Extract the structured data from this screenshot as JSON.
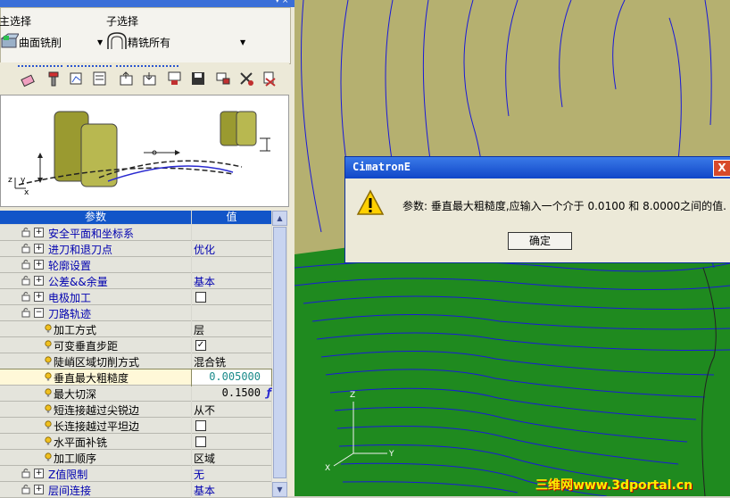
{
  "selectors": {
    "main_label": "主选择",
    "main_value": "曲面铣削",
    "sub_label": "子选择",
    "sub_value": "精铣所有"
  },
  "grid": {
    "header_param": "参数",
    "header_value": "值",
    "rows": [
      {
        "name": "安全平面和坐标系",
        "value": "",
        "kind": "group"
      },
      {
        "name": "进刀和退刀点",
        "value": "优化",
        "kind": "group"
      },
      {
        "name": "轮廓设置",
        "value": "",
        "kind": "group"
      },
      {
        "name": "公差&&余量",
        "value": "基本",
        "kind": "group"
      },
      {
        "name": "电极加工",
        "value": "",
        "kind": "group-check"
      },
      {
        "name": "刀路轨迹",
        "value": "",
        "kind": "group-open"
      },
      {
        "name": "加工方式",
        "value": "层",
        "kind": "param"
      },
      {
        "name": "可变垂直步距",
        "value": "",
        "kind": "check-on"
      },
      {
        "name": "陡峭区域切削方式",
        "value": "混合铣",
        "kind": "param"
      },
      {
        "name": "垂直最大粗糙度",
        "value": "0.005000",
        "kind": "edit"
      },
      {
        "name": "最大切深",
        "value": "0.1500",
        "kind": "param-num"
      },
      {
        "name": "短连接越过尖锐边",
        "value": "从不",
        "kind": "param"
      },
      {
        "name": "长连接越过平坦边",
        "value": "",
        "kind": "check"
      },
      {
        "name": "水平面补铣",
        "value": "",
        "kind": "check"
      },
      {
        "name": "加工顺序",
        "value": "区域",
        "kind": "param"
      },
      {
        "name": "Z值限制",
        "value": "无",
        "kind": "group"
      },
      {
        "name": "层间连接",
        "value": "基本",
        "kind": "group"
      }
    ]
  },
  "dialog": {
    "title": "CimatronE",
    "close_label": "X",
    "message": "参数: 垂直最大粗糙度,应输入一个介于 0.0100 和 8.0000之间的值.",
    "ok_label": "确定"
  },
  "watermark": "三维网www.3dportal.cn",
  "colors": {
    "viewport_sky": "#b5b070",
    "viewport_ground": "#1f8a1f",
    "toolpath": "#1a1ad8",
    "grid_header": "#1255c8",
    "dialog_title": "#1a56d8"
  }
}
